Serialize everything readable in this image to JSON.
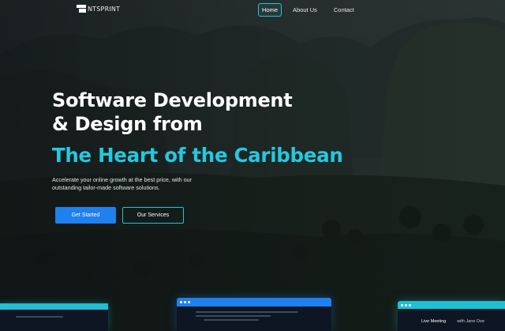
{
  "brand": {
    "name": "NTSPRINT"
  },
  "nav": {
    "items": [
      {
        "label": "Home",
        "active": true
      },
      {
        "label": "About Us",
        "active": false
      },
      {
        "label": "Contact",
        "active": false
      }
    ]
  },
  "hero": {
    "title_line1": "Software Development",
    "title_line2": "& Design from",
    "title_accent": "The Heart of the Caribbean",
    "subtitle_line1": "Accelerate your online growth at the best price, with our",
    "subtitle_line2": "outstanding tailor-made software solutions.",
    "primary_button": "Get Started",
    "secondary_button": "Our Services"
  },
  "mockups": {
    "right_card_tab1": "Live Meeting",
    "right_card_tab2": "with Jane Doe"
  },
  "colors": {
    "accent_cyan": "#25c8e0",
    "primary_blue": "#1f80ef"
  }
}
